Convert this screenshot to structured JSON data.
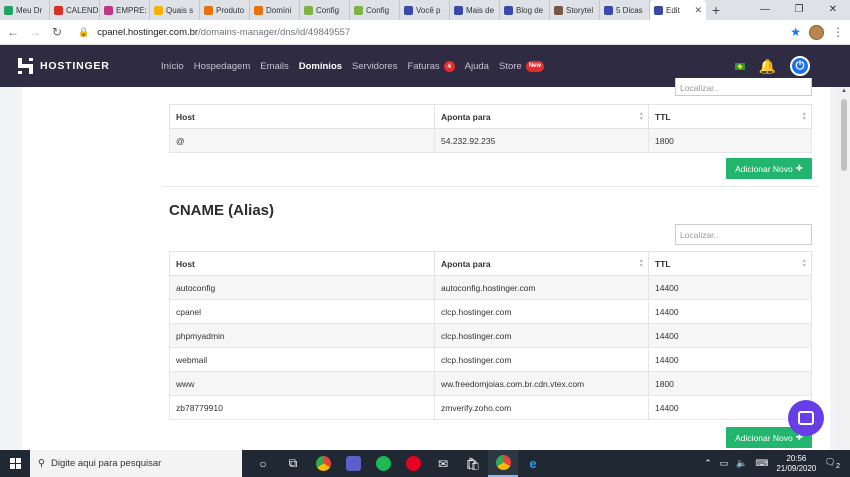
{
  "browser": {
    "tabs": [
      {
        "label": "Meu Dr",
        "color": "#1fa463"
      },
      {
        "label": "CALEND",
        "color": "#d93025"
      },
      {
        "label": "EMPRE:",
        "color": "#c13584"
      },
      {
        "label": "Quais s",
        "color": "#f4b400"
      },
      {
        "label": "Produto",
        "color": "#e8710a"
      },
      {
        "label": "Domíni",
        "color": "#e8710a"
      },
      {
        "label": "Config",
        "color": "#7cb342"
      },
      {
        "label": "Config",
        "color": "#7cb342"
      },
      {
        "label": "Você p",
        "color": "#3949ab"
      },
      {
        "label": "Mais de",
        "color": "#3949ab"
      },
      {
        "label": "Blog de",
        "color": "#3949ab"
      },
      {
        "label": "Storytel",
        "color": "#795548"
      },
      {
        "label": "5 Dicas",
        "color": "#3949ab"
      }
    ],
    "active_tab": {
      "label": "Edit",
      "color": "#3949ab"
    },
    "url_host": "cpanel.hostinger.com.br",
    "url_path": "/domains-manager/dns/id/49849557"
  },
  "header": {
    "logo_text": "HOSTINGER",
    "nav": [
      {
        "label": "Início"
      },
      {
        "label": "Hospedagem"
      },
      {
        "label": "Emails"
      },
      {
        "label": "Domínios",
        "active": true
      },
      {
        "label": "Servidores"
      },
      {
        "label": "Faturas",
        "badge": "4"
      },
      {
        "label": "Ajuda"
      },
      {
        "label": "Store",
        "badge": "New"
      }
    ]
  },
  "a_section": {
    "search_placeholder": "Localizar..",
    "columns": [
      "Host",
      "Aponta para",
      "TTL"
    ],
    "rows": [
      {
        "host": "@",
        "points_to": "54.232.92.235",
        "ttl": "1800"
      }
    ],
    "add_label": "Adicionar Novo"
  },
  "cname_section": {
    "title": "CNAME (Alias)",
    "search_placeholder": "Localizar..",
    "columns": [
      "Host",
      "Aponta para",
      "TTL"
    ],
    "rows": [
      {
        "host": "autoconfig",
        "points_to": "autoconfig.hostinger.com",
        "ttl": "14400"
      },
      {
        "host": "cpanel",
        "points_to": "clcp.hostinger.com",
        "ttl": "14400"
      },
      {
        "host": "phpmyadmin",
        "points_to": "clcp.hostinger.com",
        "ttl": "14400"
      },
      {
        "host": "webmail",
        "points_to": "clcp.hostinger.com",
        "ttl": "14400"
      },
      {
        "host": "www",
        "points_to": "ww.freedomjoias.com.br.cdn.vtex.com",
        "ttl": "1800"
      },
      {
        "host": "zb78779910",
        "points_to": "zmverify.zoho.com",
        "ttl": "14400"
      }
    ],
    "add_label": "Adicionar Novo"
  },
  "taskbar": {
    "search_placeholder": "Digite aqui para pesquisar",
    "time": "20:56",
    "date": "21/09/2020",
    "notification_count": "2"
  }
}
